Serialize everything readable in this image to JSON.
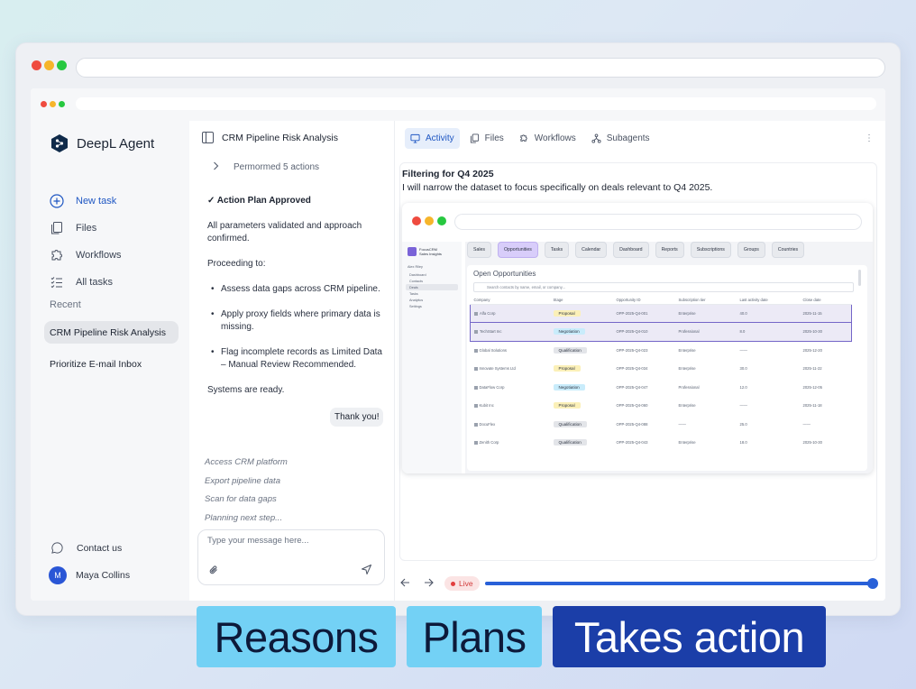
{
  "app": {
    "brand": "DeepL Agent"
  },
  "sidebar": {
    "nav": [
      {
        "label": "New task",
        "icon": "plus-circle-icon"
      },
      {
        "label": "Files",
        "icon": "files-icon"
      },
      {
        "label": "Workflows",
        "icon": "puzzle-icon"
      },
      {
        "label": "All tasks",
        "icon": "task-list-icon"
      }
    ],
    "recent_label": "Recent",
    "recent": [
      {
        "label": "CRM Pipeline Risk Analysis"
      },
      {
        "label": "Prioritize E-mail Inbox"
      }
    ],
    "contact_label": "Contact us",
    "user": {
      "initial": "M",
      "name": "Maya Collins"
    }
  },
  "chat": {
    "title": "CRM Pipeline Risk Analysis",
    "performed": "Permormed 5 actions",
    "plan_title": "✓ Action Plan Approved",
    "para1": "All parameters validated and approach confirmed.",
    "para2": "Proceeding to:",
    "bullets": [
      "Assess data gaps across CRM pipeline.",
      "Apply proxy fields where primary data is missing.",
      "Flag incomplete records as Limited Data – Manual Review Recommended."
    ],
    "para3": "Systems are ready.",
    "user_msg": "Thank you!",
    "steps": [
      "Access CRM platform",
      "Export pipeline data",
      "Scan for data gaps",
      "Planning next step..."
    ],
    "placeholder": "Type your message here..."
  },
  "panel": {
    "tabs": [
      {
        "label": "Activity",
        "icon": "monitor-icon"
      },
      {
        "label": "Files",
        "icon": "files-icon"
      },
      {
        "label": "Workflows",
        "icon": "puzzle-icon"
      },
      {
        "label": "Subagents",
        "icon": "subagents-icon"
      }
    ],
    "more": "⋮",
    "activity_title": "Filtering for Q4 2025",
    "activity_desc": "I will narrow the dataset to focus specifically on deals relevant to Q4 2025.",
    "live_label": "Live",
    "progress": 1.0
  },
  "crm": {
    "logo_line1": "FocusCRM",
    "logo_line2": "Sales Insights",
    "user": "Alex Riley",
    "nav": [
      "Dashboard",
      "Contacts",
      "Deals",
      "Tasks",
      "Analytics",
      "Settings"
    ],
    "tabs": [
      "Sales",
      "Opportunities",
      "Tasks",
      "Calendar",
      "Dashboard",
      "Reports",
      "Subscriptions",
      "Groups",
      "Countries"
    ],
    "card_title": "Open Opportunities",
    "search_placeholder": "Search contacts by name, email, or company...",
    "columns": [
      "Company",
      "Stage",
      "Opportunity ID",
      "Subscription tier",
      "Last activity date",
      "Close date"
    ],
    "rows": [
      [
        "Alfa Corp",
        "Proposal",
        "OPP-2025-Q4-001",
        "Enterprise",
        "40.0",
        "2025-11-15"
      ],
      [
        "TechStart Inc",
        "Negotiation",
        "OPP-2025-Q4-010",
        "Professional",
        "8.0",
        "2025-10-30"
      ],
      [
        "Global Solutions",
        "Qualification",
        "OPP-2025-Q4-023",
        "Enterprise",
        "——",
        "2025-12-20"
      ],
      [
        "Innovate Systems Ltd",
        "Proposal",
        "OPP-2025-Q4-034",
        "Enterprise",
        "30.0",
        "2025-11-22"
      ],
      [
        "DataFlow Corp",
        "Negotiation",
        "OPP-2025-Q4-047",
        "Professional",
        "12.0",
        "2025-12-05"
      ],
      [
        "Kubit Inc",
        "Proposal",
        "OPP-2025-Q4-060",
        "Enterprise",
        "——",
        "2025-11-18"
      ],
      [
        "DocuFlex",
        "Qualification",
        "OPP-2025-Q4-088",
        "——",
        "25.0",
        "——"
      ],
      [
        "Zenith Corp",
        "Qualification",
        "OPP-2025-Q4-043",
        "Enterprise",
        "18.0",
        "2025-10-30"
      ]
    ]
  },
  "labels": [
    "Reasons",
    "Plans",
    "Takes action"
  ],
  "colors": {
    "accent": "#1f57c3",
    "label_light": "#73d1f5",
    "label_dark": "#1b3ea8",
    "live": "#e23e3e"
  }
}
